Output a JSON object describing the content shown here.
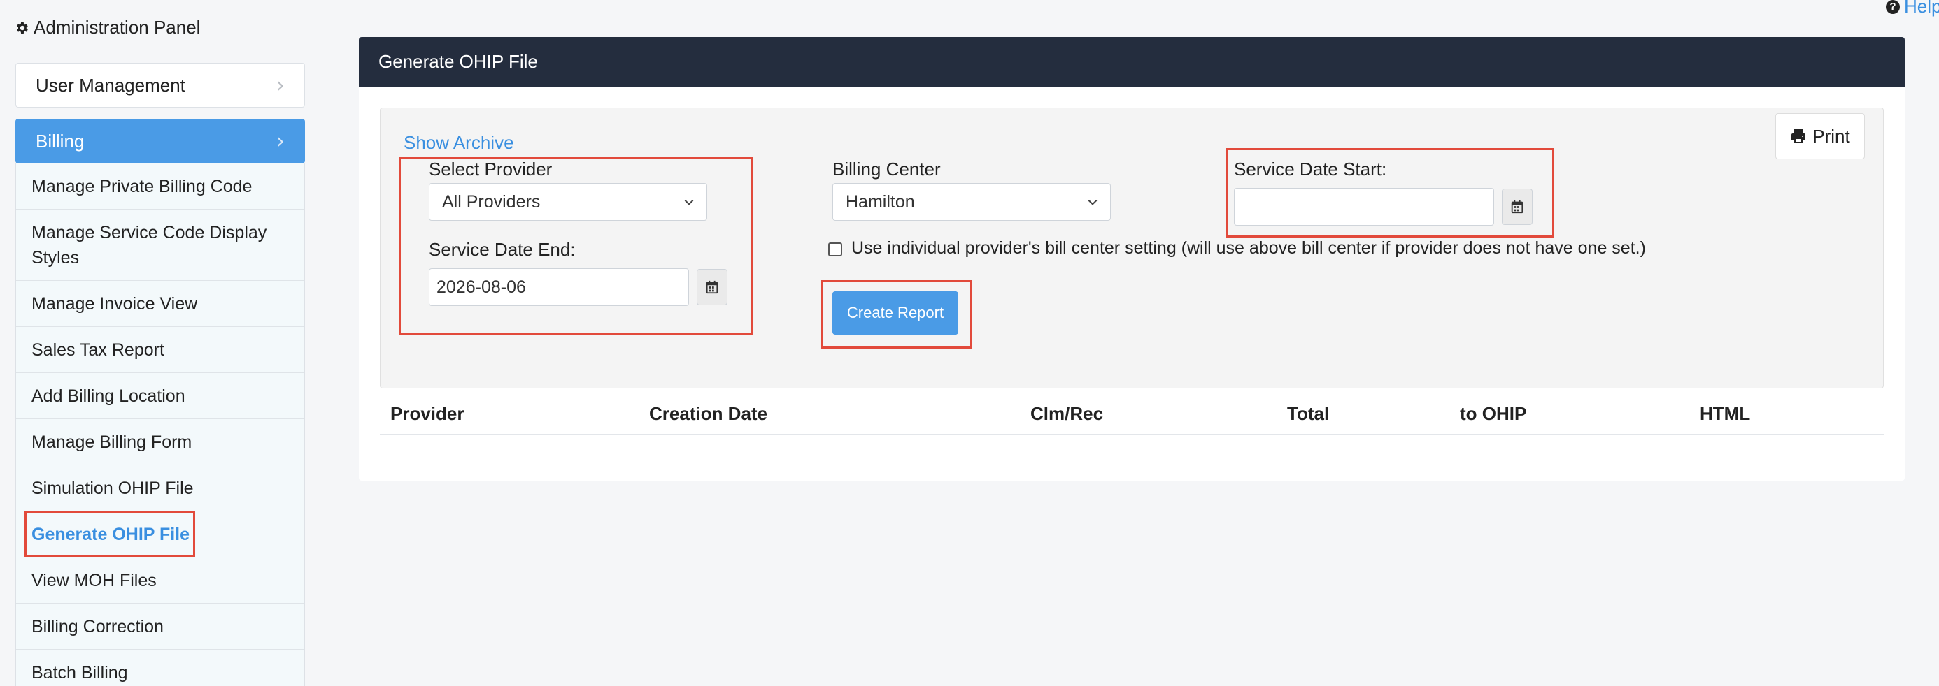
{
  "sidebar": {
    "title": "Administration Panel",
    "sections": [
      {
        "label": "User Management"
      },
      {
        "label": "Billing"
      }
    ],
    "items": [
      {
        "label": "Manage Private Billing Code"
      },
      {
        "label": "Manage Service Code Display Styles"
      },
      {
        "label": "Manage Invoice View"
      },
      {
        "label": "Sales Tax Report"
      },
      {
        "label": "Add Billing Location"
      },
      {
        "label": "Manage Billing Form"
      },
      {
        "label": "Simulation OHIP File"
      },
      {
        "label": "Generate OHIP File"
      },
      {
        "label": "View MOH Files"
      },
      {
        "label": "Billing Correction"
      },
      {
        "label": "Batch Billing"
      }
    ]
  },
  "help": {
    "label": "Help"
  },
  "panel": {
    "title": "Generate OHIP File",
    "print_label": "Print",
    "show_archive_label": "Show Archive"
  },
  "form": {
    "provider": {
      "label": "Select Provider",
      "value": "All Providers"
    },
    "service_date_end": {
      "label": "Service Date End:",
      "value": "2026-08-06"
    },
    "billing_center": {
      "label": "Billing Center",
      "value": "Hamilton"
    },
    "service_date_start": {
      "label": "Service Date Start:",
      "value": ""
    },
    "individual_setting": {
      "label": "Use individual provider's bill center setting (will use above bill center if provider does not have one set.)",
      "checked": false
    },
    "create_report_label": "Create Report"
  },
  "table": {
    "columns": [
      "Provider",
      "Creation Date",
      "Clm/Rec",
      "Total",
      "to OHIP",
      "HTML"
    ]
  },
  "colors": {
    "header_bg": "#242d3e",
    "accent_blue": "#4a9be6",
    "highlight_red": "#e24a3b"
  }
}
